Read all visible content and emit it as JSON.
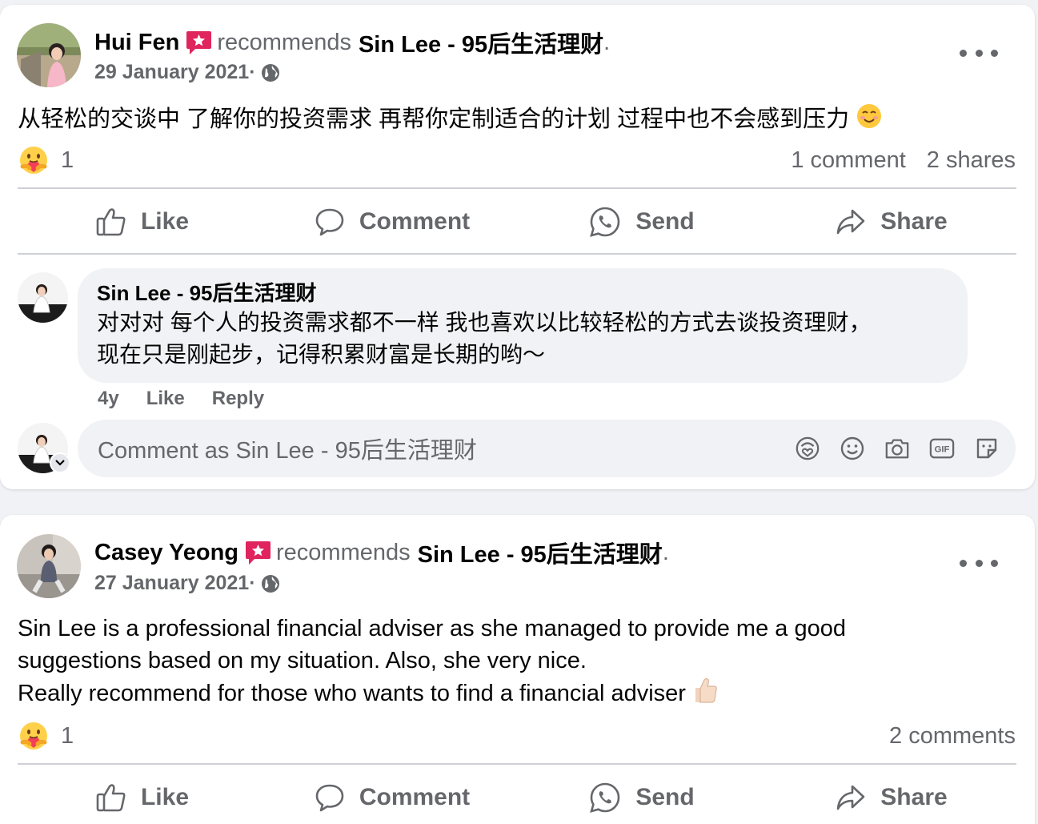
{
  "colors": {
    "text_primary": "#050505",
    "text_secondary": "#65676b",
    "badge_red": "#e0245e",
    "card_bg": "#ffffff",
    "page_bg": "#f0f2f5"
  },
  "posts": [
    {
      "author": "Hui Fen",
      "recommends": "recommends",
      "page": "Sin Lee - 95后生活理财",
      "date": "29 January 2021·",
      "text": "从轻松的交谈中 了解你的投资需求 再帮你定制适合的计划 过程中也不会感到压力",
      "text_emoji": "smiling-face-icon",
      "reaction_icon": "care-reaction-icon",
      "reaction_count": "1",
      "comments_count": "1 comment",
      "shares_count": "2 shares",
      "actions": {
        "like": "Like",
        "comment": "Comment",
        "send": "Send",
        "share": "Share"
      },
      "comment": {
        "author": "Sin Lee - 95后生活理财",
        "line1": "对对对 每个人的投资需求都不一样 我也喜欢以比较轻松的方式去谈投资理财，",
        "line2": "现在只是刚起步，记得积累财富是长期的哟～",
        "age": "4y",
        "like": "Like",
        "reply": "Reply"
      },
      "composer_placeholder": "Comment as Sin Lee - 95后生活理财"
    },
    {
      "author": "Casey Yeong",
      "recommends": "recommends",
      "page": "Sin Lee - 95后生活理财",
      "date": "27 January 2021·",
      "text_lines": [
        "Sin Lee is a professional financial adviser as she managed to provide me a good",
        "suggestions based on my situation. Also, she very nice.",
        "Really recommend for those who wants to find a financial adviser"
      ],
      "text_emoji": "thumbs-up-icon",
      "reaction_icon": "care-reaction-icon",
      "reaction_count": "1",
      "comments_count": "2 comments",
      "actions": {
        "like": "Like",
        "comment": "Comment",
        "send": "Send",
        "share": "Share"
      }
    }
  ]
}
